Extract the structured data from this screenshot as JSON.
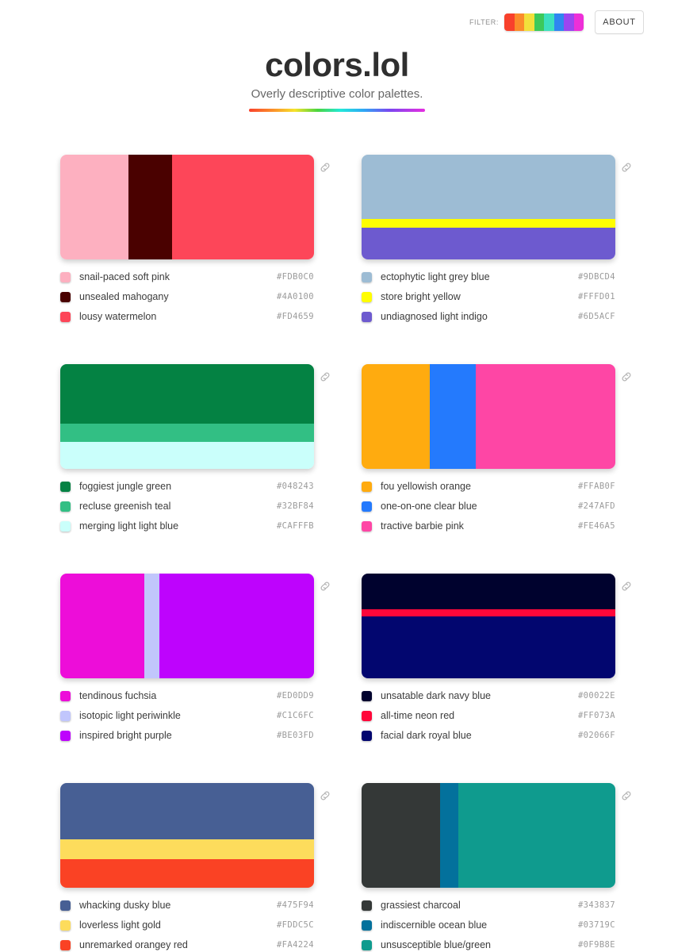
{
  "topbar": {
    "filter_label": "FILTER:",
    "filter_swatch_colors": [
      "#F8412C",
      "#FB8C2A",
      "#F2E03B",
      "#3CC95B",
      "#3CE0BE",
      "#2F86F0",
      "#9B45F0",
      "#EE2FD8"
    ],
    "about_label": "ABOUT"
  },
  "masthead": {
    "title": "colors.lol",
    "subtitle": "Overly descriptive color palettes."
  },
  "palettes": [
    {
      "orientation": "vertical",
      "link_icon": "link-icon",
      "bands": [
        {
          "color": "#FDB0C0",
          "size": 27
        },
        {
          "color": "#4A0100",
          "size": 17
        },
        {
          "color": "#FD4659",
          "size": 56
        }
      ],
      "colors": [
        {
          "name": "snail-paced soft pink",
          "hex": "#FDB0C0"
        },
        {
          "name": "unsealed mahogany",
          "hex": "#4A0100"
        },
        {
          "name": "lousy watermelon",
          "hex": "#FD4659"
        }
      ]
    },
    {
      "orientation": "horizontal",
      "link_icon": "link-icon",
      "bands": [
        {
          "color": "#9DBCD4",
          "size": 61
        },
        {
          "color": "#FFFD01",
          "size": 9
        },
        {
          "color": "#6D5ACF",
          "size": 30
        }
      ],
      "colors": [
        {
          "name": "ectophytic light grey blue",
          "hex": "#9DBCD4"
        },
        {
          "name": "store bright yellow",
          "hex": "#FFFD01"
        },
        {
          "name": "undiagnosed light indigo",
          "hex": "#6D5ACF"
        }
      ]
    },
    {
      "orientation": "horizontal",
      "link_icon": "link-icon",
      "bands": [
        {
          "color": "#048243",
          "size": 57
        },
        {
          "color": "#32BF84",
          "size": 17
        },
        {
          "color": "#CAFFFB",
          "size": 26
        }
      ],
      "colors": [
        {
          "name": "foggiest jungle green",
          "hex": "#048243"
        },
        {
          "name": "recluse greenish teal",
          "hex": "#32BF84"
        },
        {
          "name": "merging light light blue",
          "hex": "#CAFFFB"
        }
      ]
    },
    {
      "orientation": "vertical",
      "link_icon": "link-icon",
      "bands": [
        {
          "color": "#FFAB0F",
          "size": 27
        },
        {
          "color": "#247AFD",
          "size": 18
        },
        {
          "color": "#FE46A5",
          "size": 55
        }
      ],
      "colors": [
        {
          "name": "fou yellowish orange",
          "hex": "#FFAB0F"
        },
        {
          "name": "one-on-one clear blue",
          "hex": "#247AFD"
        },
        {
          "name": "tractive barbie pink",
          "hex": "#FE46A5"
        }
      ]
    },
    {
      "orientation": "vertical",
      "link_icon": "link-icon",
      "bands": [
        {
          "color": "#ED0DD9",
          "size": 33
        },
        {
          "color": "#C1C6FC",
          "size": 6
        },
        {
          "color": "#BE03FD",
          "size": 61
        }
      ],
      "colors": [
        {
          "name": "tendinous fuchsia",
          "hex": "#ED0DD9"
        },
        {
          "name": "isotopic light periwinkle",
          "hex": "#C1C6FC"
        },
        {
          "name": "inspired bright purple",
          "hex": "#BE03FD"
        }
      ]
    },
    {
      "orientation": "horizontal",
      "link_icon": "link-icon",
      "bands": [
        {
          "color": "#00022E",
          "size": 34
        },
        {
          "color": "#FF073A",
          "size": 7
        },
        {
          "color": "#02066F",
          "size": 59
        }
      ],
      "colors": [
        {
          "name": "unsatable dark navy blue",
          "hex": "#00022E"
        },
        {
          "name": "all-time neon red",
          "hex": "#FF073A"
        },
        {
          "name": "facial dark royal blue",
          "hex": "#02066F"
        }
      ]
    },
    {
      "orientation": "horizontal",
      "link_icon": "link-icon",
      "bands": [
        {
          "color": "#475F94",
          "size": 54
        },
        {
          "color": "#FDDC5C",
          "size": 19
        },
        {
          "color": "#FA4224",
          "size": 27
        }
      ],
      "colors": [
        {
          "name": "whacking dusky blue",
          "hex": "#475F94"
        },
        {
          "name": "loverless light gold",
          "hex": "#FDDC5C"
        },
        {
          "name": "unremarked orangey red",
          "hex": "#FA4224"
        }
      ]
    },
    {
      "orientation": "vertical",
      "link_icon": "link-icon",
      "bands": [
        {
          "color": "#343837",
          "size": 31
        },
        {
          "color": "#03719C",
          "size": 7
        },
        {
          "color": "#0F9B8E",
          "size": 62
        }
      ],
      "colors": [
        {
          "name": "grassiest charcoal",
          "hex": "#343837"
        },
        {
          "name": "indiscernible ocean blue",
          "hex": "#03719C"
        },
        {
          "name": "unsusceptible blue/green",
          "hex": "#0F9B8E"
        }
      ]
    }
  ]
}
